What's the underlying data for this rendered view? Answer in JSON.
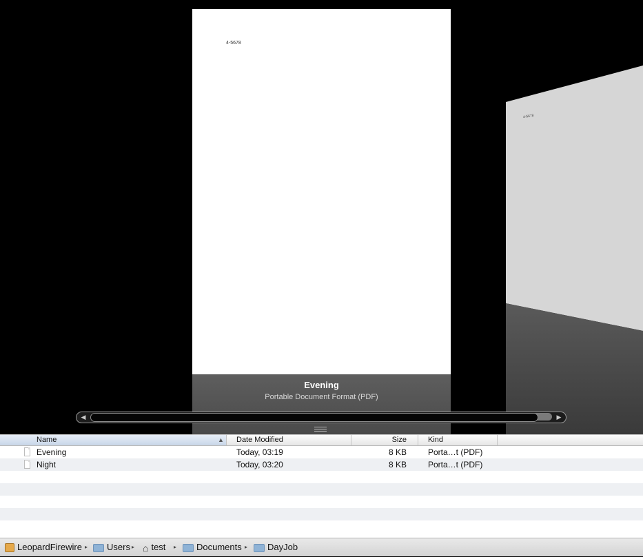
{
  "coverflow": {
    "main_page_text": "4-5678",
    "side_page_text": "4-5678",
    "title": "Evening",
    "subtitle": "Portable Document Format (PDF)",
    "scroll_position": 0.97
  },
  "columns": {
    "name": "Name",
    "date": "Date Modified",
    "size": "Size",
    "kind": "Kind",
    "sort_indicator": "▲"
  },
  "files": [
    {
      "name": "Evening",
      "date": "Today, 03:19",
      "size": "8 KB",
      "kind": "Porta…t (PDF)"
    },
    {
      "name": "Night",
      "date": "Today, 03:20",
      "size": "8 KB",
      "kind": "Porta…t (PDF)"
    }
  ],
  "path": {
    "items": [
      "LeopardFirewire",
      "Users",
      "test",
      "Documents",
      "DayJob"
    ],
    "separator": "▸"
  }
}
